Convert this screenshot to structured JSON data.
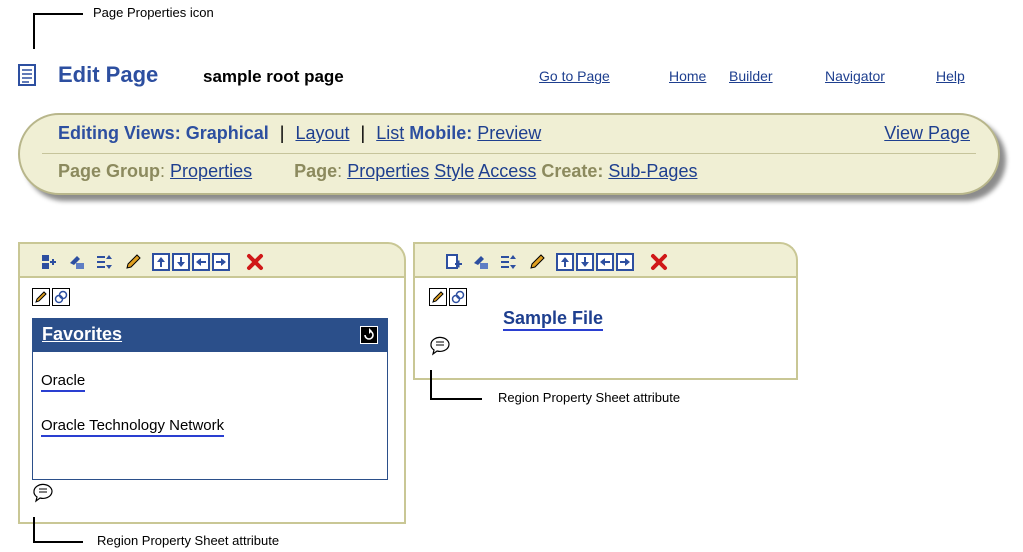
{
  "callouts": {
    "page_properties_icon": "Page Properties icon",
    "region_attr_right": "Region Property Sheet attribute",
    "region_attr_left": "Region Property Sheet attribute"
  },
  "header": {
    "title": "Edit Page",
    "subtitle": "sample root page",
    "links": [
      "Go to Page",
      "Home",
      "Builder",
      "Navigator",
      "Help"
    ]
  },
  "tabs": {
    "editing_views_label": "Editing Views:",
    "graphical": "Graphical",
    "separator": "|",
    "layout": "Layout",
    "list": "List",
    "mobile_label": "Mobile:",
    "preview": "Preview",
    "view_page": "View Page",
    "page_group_label": "Page Group",
    "colon": ":",
    "page_group_properties": "Properties",
    "page_label": "Page",
    "page_properties": "Properties",
    "style": "Style",
    "access": "Access",
    "create_label": "Create:",
    "sub_pages": "Sub-Pages"
  },
  "left_region": {
    "portlet_title": "Favorites",
    "links": [
      "Oracle",
      "Oracle Technology Network"
    ]
  },
  "right_region": {
    "item_title": "Sample File"
  },
  "colors": {
    "accent_blue": "#2d4fa0",
    "link_blue": "#1e3f8f",
    "tab_bg": "#f0efd4",
    "tab_border": "#b8b68b",
    "portlet_header": "#2b4f8a",
    "delete_red": "#d01818"
  },
  "icons": [
    "page-properties-icon",
    "add-portlet-icon",
    "add-item-icon",
    "arrange-icon",
    "edit-pencil-icon",
    "add-region-above-icon",
    "add-region-below-icon",
    "add-region-left-icon",
    "add-region-right-icon",
    "delete-region-icon",
    "edit-defaults-icon",
    "show-link-icon",
    "region-property-sheet-icon",
    "refresh-icon"
  ]
}
